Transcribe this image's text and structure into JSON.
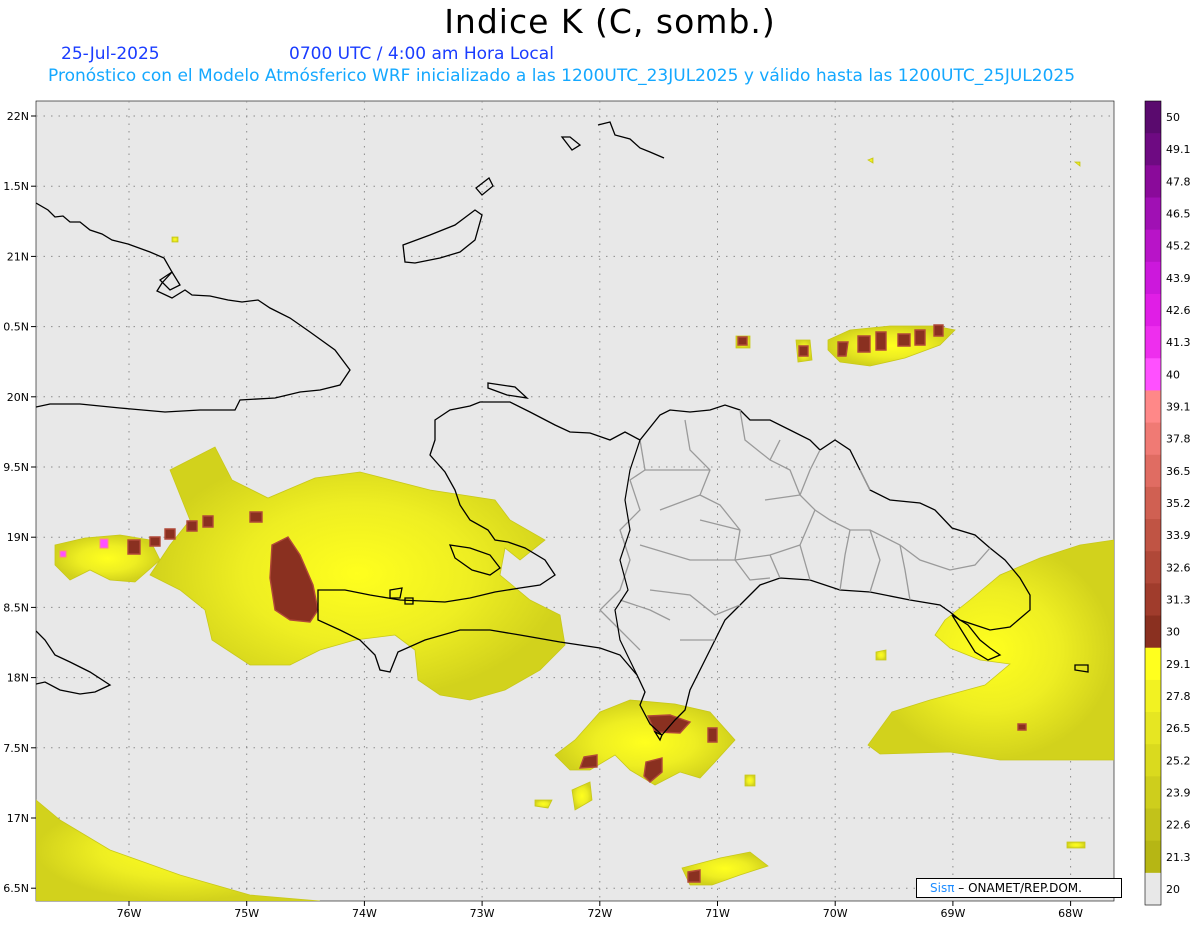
{
  "title": "Indice K (C, somb.)",
  "date_label": "25-Jul-2025",
  "time_label": "0700 UTC / 4:00 am Hora Local",
  "subtitle": "Pronóstico con el Modelo Atmósferico WRF inicializado a las 1200UTC_23JUL2025 y válido hasta las  1200UTC_25JUL2025",
  "lat_labels": [
    "22N",
    "1.5N",
    "21N",
    "0.5N",
    "20N",
    "9.5N",
    "19N",
    "8.5N",
    "18N",
    "7.5N",
    "17N",
    "6.5N"
  ],
  "lon_labels": [
    "76W",
    "75W",
    "74W",
    "73W",
    "72W",
    "71W",
    "70W",
    "69W",
    "68W"
  ],
  "colorbar": {
    "levels": [
      "50",
      "49.1",
      "47.8",
      "46.5",
      "45.2",
      "43.9",
      "42.6",
      "41.3",
      "40",
      "39.1",
      "37.8",
      "36.5",
      "35.2",
      "33.9",
      "32.6",
      "31.3",
      "30",
      "29.1",
      "27.8",
      "26.5",
      "25.2",
      "23.9",
      "22.6",
      "21.3",
      "20"
    ],
    "colors": [
      "#5a0a6e",
      "#6e0a82",
      "#8a0a9a",
      "#a010b4",
      "#b814c8",
      "#cc18dc",
      "#e01ee6",
      "#ee2eee",
      "#ff50ff",
      "#ff8888",
      "#f07a74",
      "#e06c62",
      "#d06052",
      "#c05444",
      "#b04838",
      "#a03c2c",
      "#8a3020",
      "#ffff1e",
      "#f2f222",
      "#e6e622",
      "#dada1e",
      "#cece1c",
      "#c2c21a",
      "#b6b614",
      "#e8e8e8"
    ]
  },
  "credit": {
    "sis": "Sisπ",
    "rest": "– ONAMET/REP.DOM."
  }
}
